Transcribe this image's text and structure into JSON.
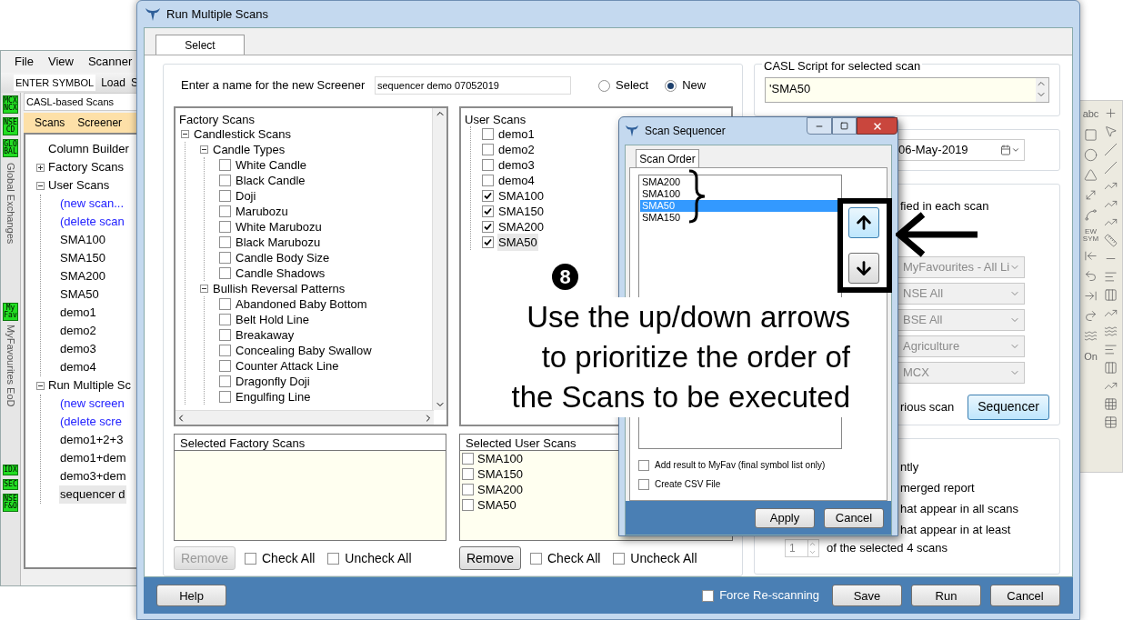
{
  "background_app": {
    "menu": [
      "File",
      "View",
      "Scanner"
    ],
    "toolbar": {
      "symbol_field": "ENTER SYMBOL",
      "buttons": [
        "Load",
        "S"
      ]
    },
    "side_badges_top": [
      {
        "lines": [
          "MCX",
          "NCX"
        ]
      },
      {
        "lines": [
          "NSE",
          "CD"
        ]
      },
      {
        "lines": [
          "GLO",
          "BAL"
        ]
      }
    ],
    "side_tab_1": "Global Exchanges",
    "side_badge_fav": {
      "lines": [
        "My",
        "Fav"
      ]
    },
    "side_tab_2": "MyFavourites EoD",
    "side_badges_bottom": [
      {
        "lines": [
          "IDX"
        ]
      },
      {
        "lines": [
          "SEC"
        ]
      },
      {
        "lines": [
          "NSE",
          "F&O"
        ]
      }
    ],
    "panel_title": "CASL-based Scans",
    "panel_tabs": [
      "Scans",
      "Screener"
    ],
    "tree": [
      {
        "label": "Column Builder"
      },
      {
        "label": "Factory Scans",
        "expanded": false
      },
      {
        "label": "User Scans",
        "expanded": true,
        "children": [
          {
            "label": "(new scan...",
            "kind": "action",
            "selected": false
          },
          {
            "label": "(delete scan",
            "kind": "action",
            "selected": false
          },
          {
            "label": "SMA100",
            "kind": "item",
            "selected": false
          },
          {
            "label": "SMA150",
            "kind": "item",
            "selected": false
          },
          {
            "label": "SMA200",
            "kind": "item",
            "selected": false
          },
          {
            "label": "SMA50",
            "kind": "item",
            "selected": false
          },
          {
            "label": "demo1",
            "kind": "item",
            "selected": false
          },
          {
            "label": "demo2",
            "kind": "item",
            "selected": false
          },
          {
            "label": "demo3",
            "kind": "item",
            "selected": false
          },
          {
            "label": "demo4",
            "kind": "item",
            "selected": false
          }
        ]
      },
      {
        "label": "Run Multiple Sc",
        "expanded": true,
        "children": [
          {
            "label": "(new screen",
            "kind": "action",
            "selected": false
          },
          {
            "label": "(delete scre",
            "kind": "action",
            "selected": false
          },
          {
            "label": "demo1+2+3",
            "kind": "item",
            "selected": false
          },
          {
            "label": "demo1+dem",
            "kind": "item",
            "selected": false
          },
          {
            "label": "demo3+dem",
            "kind": "item",
            "selected": false
          },
          {
            "label": "sequencer d",
            "kind": "item",
            "selected": true
          }
        ]
      }
    ]
  },
  "dialog": {
    "title": "Run Multiple Scans",
    "tabs": [
      {
        "label": "Select",
        "selected": true
      }
    ],
    "name_label": "Enter a name for the new Screener",
    "name_value": "sequencer demo 07052019",
    "modes": [
      {
        "label": "Select",
        "selected": false
      },
      {
        "label": "New",
        "selected": true
      }
    ],
    "factory_tree": {
      "title": "Factory Scans",
      "children": [
        {
          "label": "Candlestick Scans",
          "expanded": true,
          "children": [
            {
              "label": "Candle Types",
              "expanded": true,
              "children": [
                {
                  "label": "White Candle",
                  "checked": false
                },
                {
                  "label": "Black Candle",
                  "checked": false
                },
                {
                  "label": "Doji",
                  "checked": false
                },
                {
                  "label": "Marubozu",
                  "checked": false
                },
                {
                  "label": "White Marubozu",
                  "checked": false
                },
                {
                  "label": "Black Marubozu",
                  "checked": false
                },
                {
                  "label": "Candle Body Size",
                  "checked": false
                },
                {
                  "label": "Candle Shadows",
                  "checked": false
                }
              ]
            },
            {
              "label": "Bullish Reversal Patterns",
              "expanded": true,
              "children": [
                {
                  "label": "Abandoned Baby Bottom",
                  "checked": false
                },
                {
                  "label": "Belt Hold Line",
                  "checked": false
                },
                {
                  "label": "Breakaway",
                  "checked": false
                },
                {
                  "label": "Concealing Baby Swallow",
                  "checked": false
                },
                {
                  "label": "Counter Attack Line",
                  "checked": false
                },
                {
                  "label": "Dragonfly Doji",
                  "checked": false
                },
                {
                  "label": "Engulfing Line",
                  "checked": false
                }
              ]
            }
          ]
        }
      ]
    },
    "user_tree": {
      "title": "User Scans",
      "items": [
        {
          "label": "demo1",
          "checked": false,
          "selected": false
        },
        {
          "label": "demo2",
          "checked": false,
          "selected": false
        },
        {
          "label": "demo3",
          "checked": false,
          "selected": false
        },
        {
          "label": "demo4",
          "checked": false,
          "selected": false
        },
        {
          "label": "SMA100",
          "checked": true,
          "selected": false
        },
        {
          "label": "SMA150",
          "checked": true,
          "selected": false
        },
        {
          "label": "SMA200",
          "checked": true,
          "selected": false
        },
        {
          "label": "SMA50",
          "checked": true,
          "selected": true
        }
      ]
    },
    "selected_factory": {
      "title": "Selected Factory Scans"
    },
    "selected_user": {
      "title": "Selected User Scans",
      "items": [
        {
          "label": "SMA100",
          "checked": false
        },
        {
          "label": "SMA150",
          "checked": false
        },
        {
          "label": "SMA200",
          "checked": false
        },
        {
          "label": "SMA50",
          "checked": false
        }
      ]
    },
    "factory_actions": {
      "remove": {
        "label": "Remove",
        "disabled": true
      },
      "check_all": {
        "label": "Check All",
        "checked": false
      },
      "uncheck_all": {
        "label": "Uncheck All",
        "checked": false
      }
    },
    "user_actions": {
      "remove": {
        "label": "Remove",
        "disabled": false
      },
      "check_all": {
        "label": "Check All",
        "checked": false
      },
      "uncheck_all": {
        "label": "Uncheck All",
        "checked": false
      }
    },
    "script_group": {
      "title": "CASL Script for selected scan",
      "value": "'SMA50"
    },
    "date_value": "06-May-2019",
    "option_text": "fied in each scan",
    "dropdowns": [
      {
        "value": "MyFavourites - All Li",
        "disabled": true
      },
      {
        "value": "NSE All",
        "disabled": true
      },
      {
        "value": "BSE All",
        "disabled": true
      },
      {
        "value": "Agriculture",
        "disabled": true
      },
      {
        "value": "MCX",
        "disabled": true
      }
    ],
    "previous_scan_text": "rious scan",
    "sequencer_button": "Sequencer",
    "output_options": [
      "ntly",
      "merged report",
      "hat appear in all scans",
      "hat appear in at least"
    ],
    "spinner_value": "1",
    "spinner_suffix": "of the selected 4 scans",
    "footer": {
      "help": "Help",
      "force": {
        "label": "Force Re-scanning",
        "checked": false
      },
      "buttons": [
        "Save",
        "Run",
        "Cancel"
      ]
    }
  },
  "sequencer": {
    "title": "Scan Sequencer",
    "tab": "Scan Order",
    "items": [
      {
        "label": "SMA200",
        "selected": false
      },
      {
        "label": "SMA100",
        "selected": false
      },
      {
        "label": "SMA50",
        "selected": true
      },
      {
        "label": "SMA150",
        "selected": false
      }
    ],
    "options": [
      {
        "label": "Add result to MyFav (final symbol list only)",
        "checked": false
      },
      {
        "label": "Create CSV File",
        "checked": false
      }
    ],
    "buttons": [
      "Apply",
      "Cancel"
    ]
  },
  "annotation": {
    "step": "8",
    "lines": [
      "Use the up/down arrows",
      "to prioritize the order of",
      "the Scans to be executed"
    ]
  },
  "right_toolbar": {
    "text_tools": [
      "abc",
      "EW SYM",
      "On"
    ]
  }
}
